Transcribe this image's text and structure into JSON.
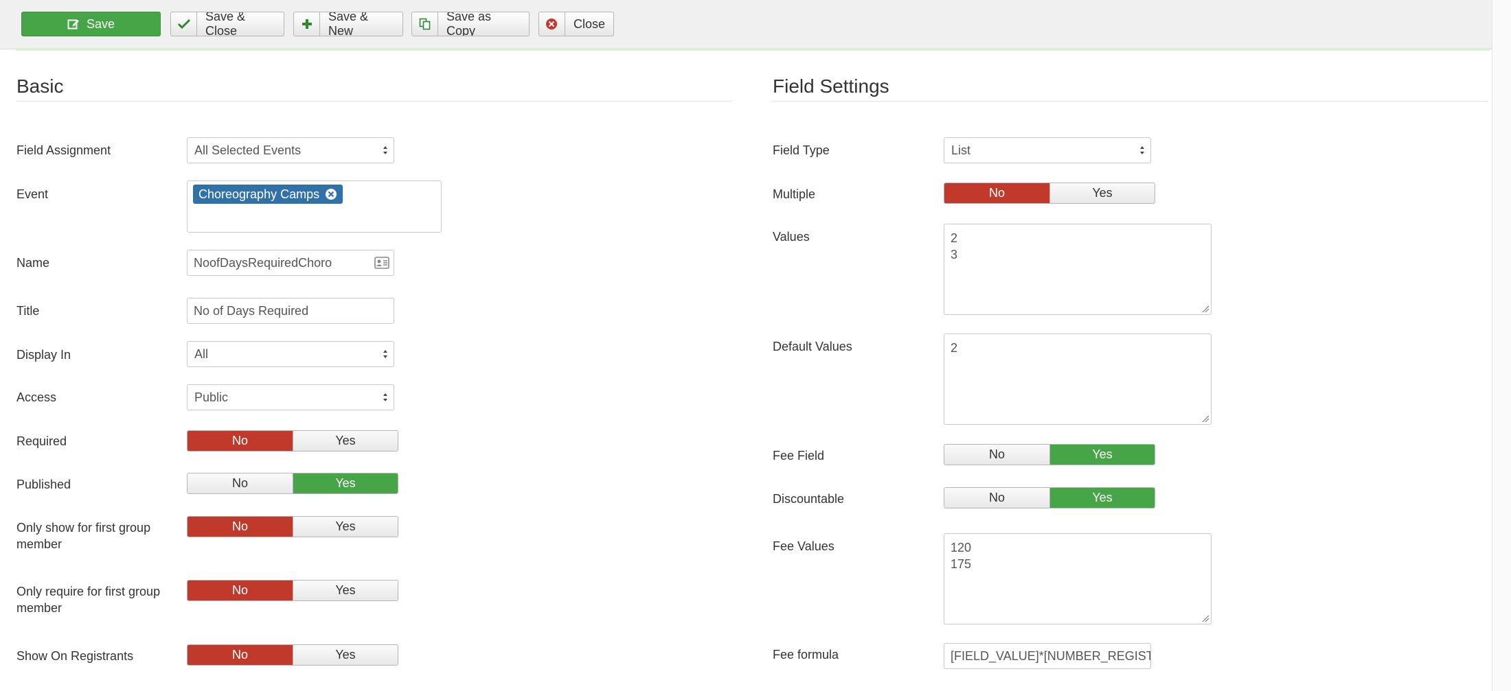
{
  "toolbar": {
    "save": "Save",
    "save_close": "Save & Close",
    "save_new": "Save & New",
    "save_copy": "Save as Copy",
    "close": "Close"
  },
  "basic": {
    "title": "Basic",
    "field_assignment": {
      "label": "Field Assignment",
      "value": "All Selected Events"
    },
    "event": {
      "label": "Event",
      "chips": [
        "Choreography Camps"
      ]
    },
    "name": {
      "label": "Name",
      "value": "NoofDaysRequiredChoro"
    },
    "title_field": {
      "label": "Title",
      "value": "No of Days Required"
    },
    "display_in": {
      "label": "Display In",
      "value": "All"
    },
    "access": {
      "label": "Access",
      "value": "Public"
    },
    "required": {
      "label": "Required",
      "selected": "No"
    },
    "published": {
      "label": "Published",
      "selected": "Yes"
    },
    "only_show_first": {
      "label": "Only show for first group member",
      "selected": "No"
    },
    "only_require_first": {
      "label": "Only require for first group member",
      "selected": "No"
    },
    "show_on_registrants": {
      "label": "Show On Registrants",
      "selected": "No"
    }
  },
  "settings": {
    "title": "Field Settings",
    "field_type": {
      "label": "Field Type",
      "value": "List"
    },
    "multiple": {
      "label": "Multiple",
      "selected": "No"
    },
    "values": {
      "label": "Values",
      "lines": [
        "2",
        "3"
      ]
    },
    "default_values": {
      "label": "Default Values",
      "lines": [
        "2"
      ]
    },
    "fee_field": {
      "label": "Fee Field",
      "selected": "Yes"
    },
    "discountable": {
      "label": "Discountable",
      "selected": "Yes"
    },
    "fee_values": {
      "label": "Fee Values",
      "lines": [
        "120",
        "175"
      ]
    },
    "fee_formula": {
      "label": "Fee formula",
      "value": "[FIELD_VALUE]*[NUMBER_REGIST"
    }
  },
  "toggle_options": {
    "no": "No",
    "yes": "Yes"
  },
  "colors": {
    "accent_green": "#46a546",
    "accent_red": "#c0392b",
    "chip_blue": "#3071a9"
  },
  "icons": [
    "edit-icon",
    "check-icon",
    "plus-icon",
    "copy-icon",
    "close-circle-icon",
    "remove-chip-icon",
    "id-card-icon",
    "select-arrows-icon",
    "resize-grip-icon"
  ]
}
